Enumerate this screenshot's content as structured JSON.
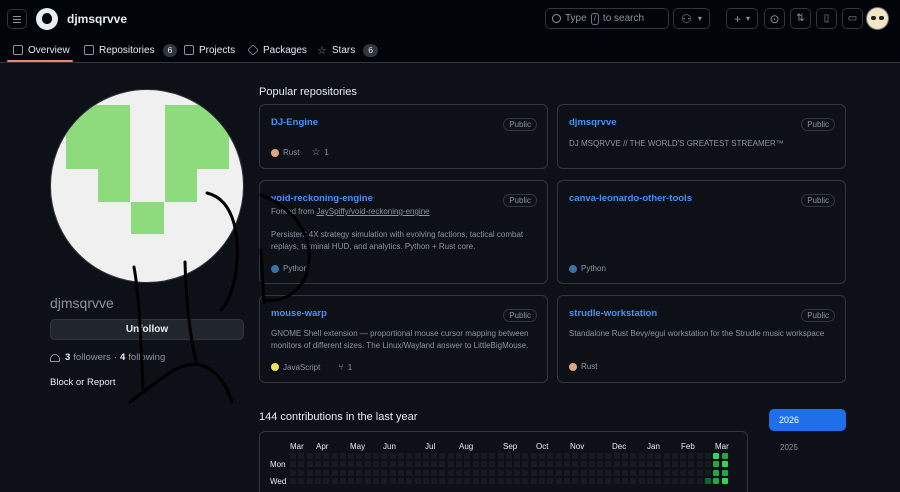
{
  "header": {
    "username": "djmsqrvve",
    "search_placeholder_pre": "Type",
    "search_key": "/",
    "search_placeholder_post": "to search",
    "plus_label": "+"
  },
  "tabs": [
    {
      "label": "Overview"
    },
    {
      "label": "Repositories",
      "count": "6"
    },
    {
      "label": "Projects"
    },
    {
      "label": "Packages"
    },
    {
      "label": "Stars",
      "count": "6"
    }
  ],
  "profile": {
    "name": "djmsqrvve",
    "follow_button": "Unfollow",
    "followers_count": "3",
    "followers_label": "followers",
    "separator": "·",
    "following_count": "4",
    "following_label": "following",
    "block_report": "Block or Report"
  },
  "popular": {
    "title": "Popular repositories",
    "repos": [
      {
        "name": "DJ-Engine",
        "visibility": "Public",
        "language": "Rust",
        "lang_color": "#dea584",
        "stars": "1"
      },
      {
        "name": "djmsqrvve",
        "visibility": "Public",
        "description": "DJ MSQRVVE // THE WORLD'S GREATEST STREAMER™"
      },
      {
        "name": "void-reckoning-engine",
        "visibility": "Public",
        "forked_prefix": "Forked from",
        "forked_from": "JaySpiffy/void-reckoning-engine",
        "description": "Persistent 4X strategy simulation with evolving factions, tactical combat replays, terminal HUD, and analytics. Python + Rust core.",
        "language": "Python",
        "lang_color": "#3572A5"
      },
      {
        "name": "canva-leonardo-other-tools",
        "visibility": "Public",
        "language": "Python",
        "lang_color": "#3572A5"
      },
      {
        "name": "mouse-warp",
        "visibility": "Public",
        "description": "GNOME Shell extension — proportional mouse cursor mapping between monitors of different sizes. The Linux/Wayland answer to LittleBigMouse.",
        "language": "JavaScript",
        "lang_color": "#f1e05a",
        "forks": "1"
      },
      {
        "name": "strudle-workstation",
        "visibility": "Public",
        "description": "Standalone Rust Bevy/egui workstation for the Strudle music workspace",
        "language": "Rust",
        "lang_color": "#dea584"
      }
    ]
  },
  "contributions": {
    "title": "144 contributions in the last year",
    "months": [
      "Mar",
      "Apr",
      "May",
      "Jun",
      "Jul",
      "Aug",
      "Sep",
      "Oct",
      "Nov",
      "Dec",
      "Jan",
      "Feb",
      "Mar"
    ],
    "day_labels": [
      "Mon",
      "Wed"
    ],
    "years": [
      "2026",
      "2025"
    ]
  },
  "colors": {
    "accent": "#f78166",
    "link": "#4493f8",
    "year_active": "#1f6feb",
    "contrib_high": "#39d353",
    "contrib_mid": "#26a641",
    "contrib_low": "#006d32"
  }
}
